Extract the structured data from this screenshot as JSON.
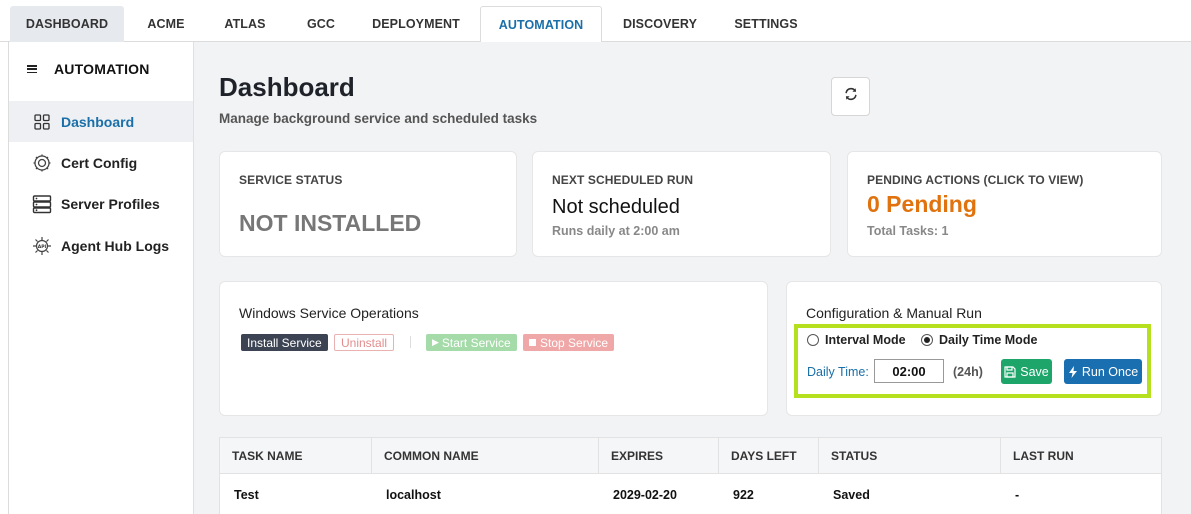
{
  "top_tabs": [
    "DASHBOARD",
    "ACME",
    "ATLAS",
    "GCC",
    "DEPLOYMENT",
    "AUTOMATION",
    "DISCOVERY",
    "SETTINGS"
  ],
  "active_tab": "AUTOMATION",
  "sidebar": {
    "title": "AUTOMATION",
    "items": [
      {
        "label": "Dashboard",
        "icon": "grid-icon",
        "active": true
      },
      {
        "label": "Cert Config",
        "icon": "gear-icon",
        "active": false
      },
      {
        "label": "Server Profiles",
        "icon": "server-icon",
        "active": false
      },
      {
        "label": "Agent Hub Logs",
        "icon": "api-log-icon",
        "active": false
      }
    ]
  },
  "header": {
    "title": "Dashboard",
    "subtitle": "Manage background service and scheduled tasks",
    "refresh_icon": "refresh-icon"
  },
  "status_cards": {
    "service": {
      "label": "SERVICE STATUS",
      "value": "NOT INSTALLED"
    },
    "next_run": {
      "label": "NEXT SCHEDULED RUN",
      "value": "Not scheduled",
      "sub": "Runs daily at 2:00 am"
    },
    "pending": {
      "label": "PENDING ACTIONS (CLICK TO VIEW)",
      "value": "0 Pending",
      "sub": "Total Tasks: 1"
    }
  },
  "service_ops": {
    "title": "Windows Service Operations",
    "install": "Install Service",
    "uninstall": "Uninstall",
    "start": "Start Service",
    "stop": "Stop Service"
  },
  "config": {
    "title": "Configuration & Manual Run",
    "mode_interval": "Interval Mode",
    "mode_daily": "Daily Time Mode",
    "selected_mode": "Daily Time Mode",
    "daily_time_label": "Daily Time:",
    "daily_time_value": "02:00",
    "time_hint": "(24h)",
    "save": "Save",
    "run_once": "Run Once"
  },
  "tasks_table": {
    "columns": [
      "TASK NAME",
      "COMMON NAME",
      "EXPIRES",
      "DAYS LEFT",
      "STATUS",
      "LAST RUN"
    ],
    "rows": [
      [
        "Test",
        "localhost",
        "2029-02-20",
        "922",
        "Saved",
        "-"
      ]
    ]
  },
  "colors": {
    "accent": "#1a6fa8",
    "pending_orange": "#e0730e",
    "highlight_green": "#b4e01e",
    "save_green": "#1ea56a",
    "run_blue": "#1a6fb0"
  }
}
